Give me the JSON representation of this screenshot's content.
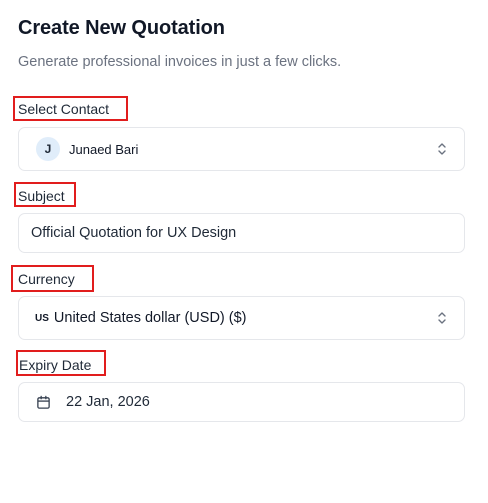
{
  "header": {
    "title": "Create New Quotation",
    "subtitle": "Generate professional invoices in just a few clicks."
  },
  "form": {
    "contact": {
      "label": "Select Contact",
      "avatar_initial": "J",
      "value": "Junaed Bari",
      "icon": "chevron-up-down-icon"
    },
    "subject": {
      "label": "Subject",
      "value": "Official Quotation for UX Design"
    },
    "currency": {
      "label": "Currency",
      "code": "US",
      "value": "United States dollar (USD) ($)",
      "icon": "chevron-up-down-icon"
    },
    "expiry": {
      "label": "Expiry Date",
      "value": "22 Jan, 2026",
      "icon": "calendar-icon"
    }
  },
  "colors": {
    "highlight": "#e11d1d",
    "avatar_bg": "#e0edfa",
    "border": "#e5e7eb"
  }
}
